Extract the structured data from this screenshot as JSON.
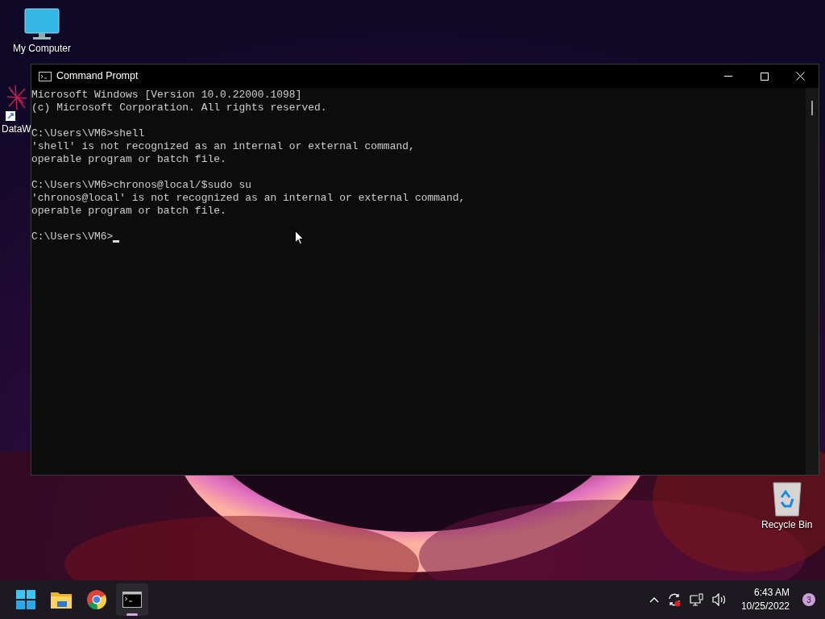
{
  "desktop_icons": [
    {
      "kind": "computer",
      "label": "My Computer"
    },
    {
      "kind": "shortcut",
      "label": "DataW"
    },
    {
      "kind": "recycle_bin",
      "label": "Recycle Bin"
    }
  ],
  "window": {
    "title": "Command Prompt",
    "console_blocks": [
      {
        "lines": [
          "Microsoft Windows [Version 10.0.22000.1098]",
          "(c) Microsoft Corporation. All rights reserved."
        ]
      },
      {
        "lines": [
          "C:\\Users\\VM6>shell",
          "'shell' is not recognized as an internal or external command,",
          "operable program or batch file."
        ]
      },
      {
        "lines": [
          "C:\\Users\\VM6>chronos@local/$sudo su",
          "'chronos@local' is not recognized as an internal or external command,",
          "operable program or batch file."
        ]
      }
    ],
    "prompt": "C:\\Users\\VM6>"
  },
  "taskbar": {
    "apps": [
      {
        "kind": "start",
        "selected": false
      },
      {
        "kind": "explorer",
        "selected": false
      },
      {
        "kind": "chrome",
        "selected": false
      },
      {
        "kind": "terminal",
        "selected": true
      }
    ],
    "time": "6:43 AM",
    "date": "10/25/2022",
    "notification_count": "3"
  }
}
